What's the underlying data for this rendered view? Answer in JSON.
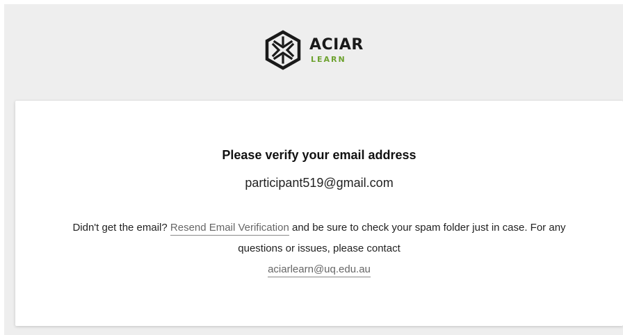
{
  "brand": {
    "name": "ACIAR",
    "sub": "LEARN",
    "accent_color": "#6da22f",
    "icon": "aciar-hexagon-logo"
  },
  "verify": {
    "title": "Please verify your email address",
    "email": "participant519@gmail.com",
    "msg_prefix": "Didn't get the email?",
    "resend_link": "Resend Email Verification",
    "msg_middle": "and be sure to check your spam folder just in case. For any questions or issues, please contact",
    "contact_email": "aciarlearn@uq.edu.au"
  }
}
